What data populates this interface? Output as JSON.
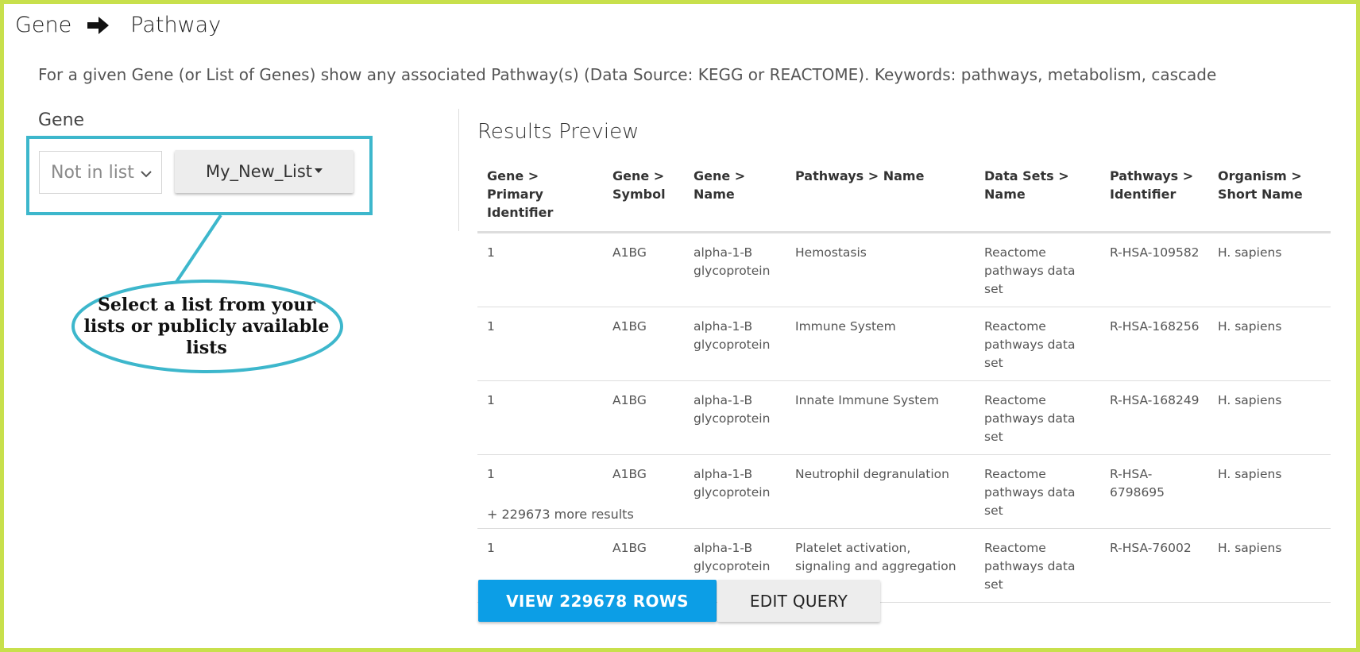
{
  "header": {
    "source": "Gene",
    "target": "Pathway",
    "arrow_icon": "arrow-right-icon"
  },
  "description": "For a given Gene (or List of Genes) show any associated Pathway(s) (Data Source: KEGG or REACTOME). Keywords: pathways, metabolism, cascade",
  "constraint": {
    "label": "Gene",
    "operator_value": "Not in list",
    "list_value": "My_New_List"
  },
  "callout": {
    "text": "Select a list from your lists or publicly available lists",
    "color": "#3db7cc"
  },
  "results": {
    "title": "Results Preview",
    "columns": [
      "Gene > Primary Identifier",
      "Gene > Symbol",
      "Gene > Name",
      "Pathways > Name",
      "Data Sets > Name",
      "Pathways > Identifier",
      "Organism > Short Name"
    ],
    "rows": [
      [
        "1",
        "A1BG",
        "alpha-1-B glycoprotein",
        "Hemostasis",
        "Reactome pathways data set",
        "R-HSA-109582",
        "H. sapiens"
      ],
      [
        "1",
        "A1BG",
        "alpha-1-B glycoprotein",
        "Immune System",
        "Reactome pathways data set",
        "R-HSA-168256",
        "H. sapiens"
      ],
      [
        "1",
        "A1BG",
        "alpha-1-B glycoprotein",
        "Innate Immune System",
        "Reactome pathways data set",
        "R-HSA-168249",
        "H. sapiens"
      ],
      [
        "1",
        "A1BG",
        "alpha-1-B glycoprotein",
        "Neutrophil degranulation",
        "Reactome pathways data set",
        "R-HSA-6798695",
        "H. sapiens"
      ],
      [
        "1",
        "A1BG",
        "alpha-1-B glycoprotein",
        "Platelet activation, signaling and aggregation",
        "Reactome pathways data set",
        "R-HSA-76002",
        "H. sapiens"
      ]
    ],
    "more_text": "+ 229673 more results"
  },
  "actions": {
    "view_label": "VIEW 229678 ROWS",
    "edit_label": "EDIT QUERY"
  },
  "colors": {
    "frame_border": "#c8e04c",
    "highlight_border": "#3db7cc",
    "primary_button": "#0c9ee6"
  }
}
